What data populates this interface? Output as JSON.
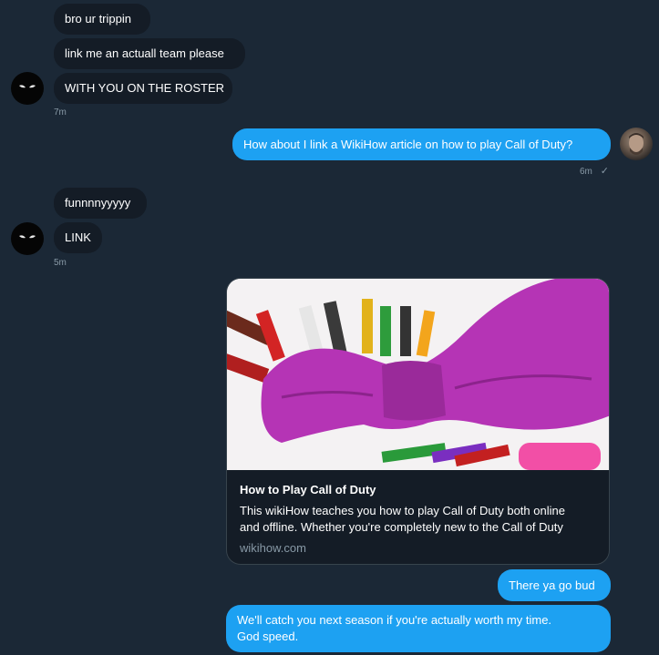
{
  "conversation": {
    "group1": {
      "messages": [
        "bro ur trippin",
        "link me an actuall team please",
        "WITH YOU ON THE ROSTER"
      ],
      "time": "7m"
    },
    "out1": {
      "text": "How about I link a WikiHow article on how to play Call of Duty?",
      "time": "6m",
      "status_icon": "✓"
    },
    "group2": {
      "messages": [
        "funnnnyyyyy",
        "LINK"
      ],
      "time": "5m"
    },
    "link_card": {
      "title": "How to Play Call of Duty",
      "description_line1": "This wikiHow teaches you how to play Call of Duty both online",
      "description_line2": "and offline. Whether you're completely new to the Call of Duty",
      "domain": "wikihow.com"
    },
    "out2": {
      "text": "There ya go bud"
    },
    "out3": {
      "line1": "We'll catch you next season if you're actually worth my time.",
      "line2": "God speed."
    }
  },
  "colors": {
    "background": "#1b2836",
    "incoming_bubble": "#141c26",
    "outgoing_bubble": "#1da1f2",
    "muted_text": "#8899a6"
  }
}
